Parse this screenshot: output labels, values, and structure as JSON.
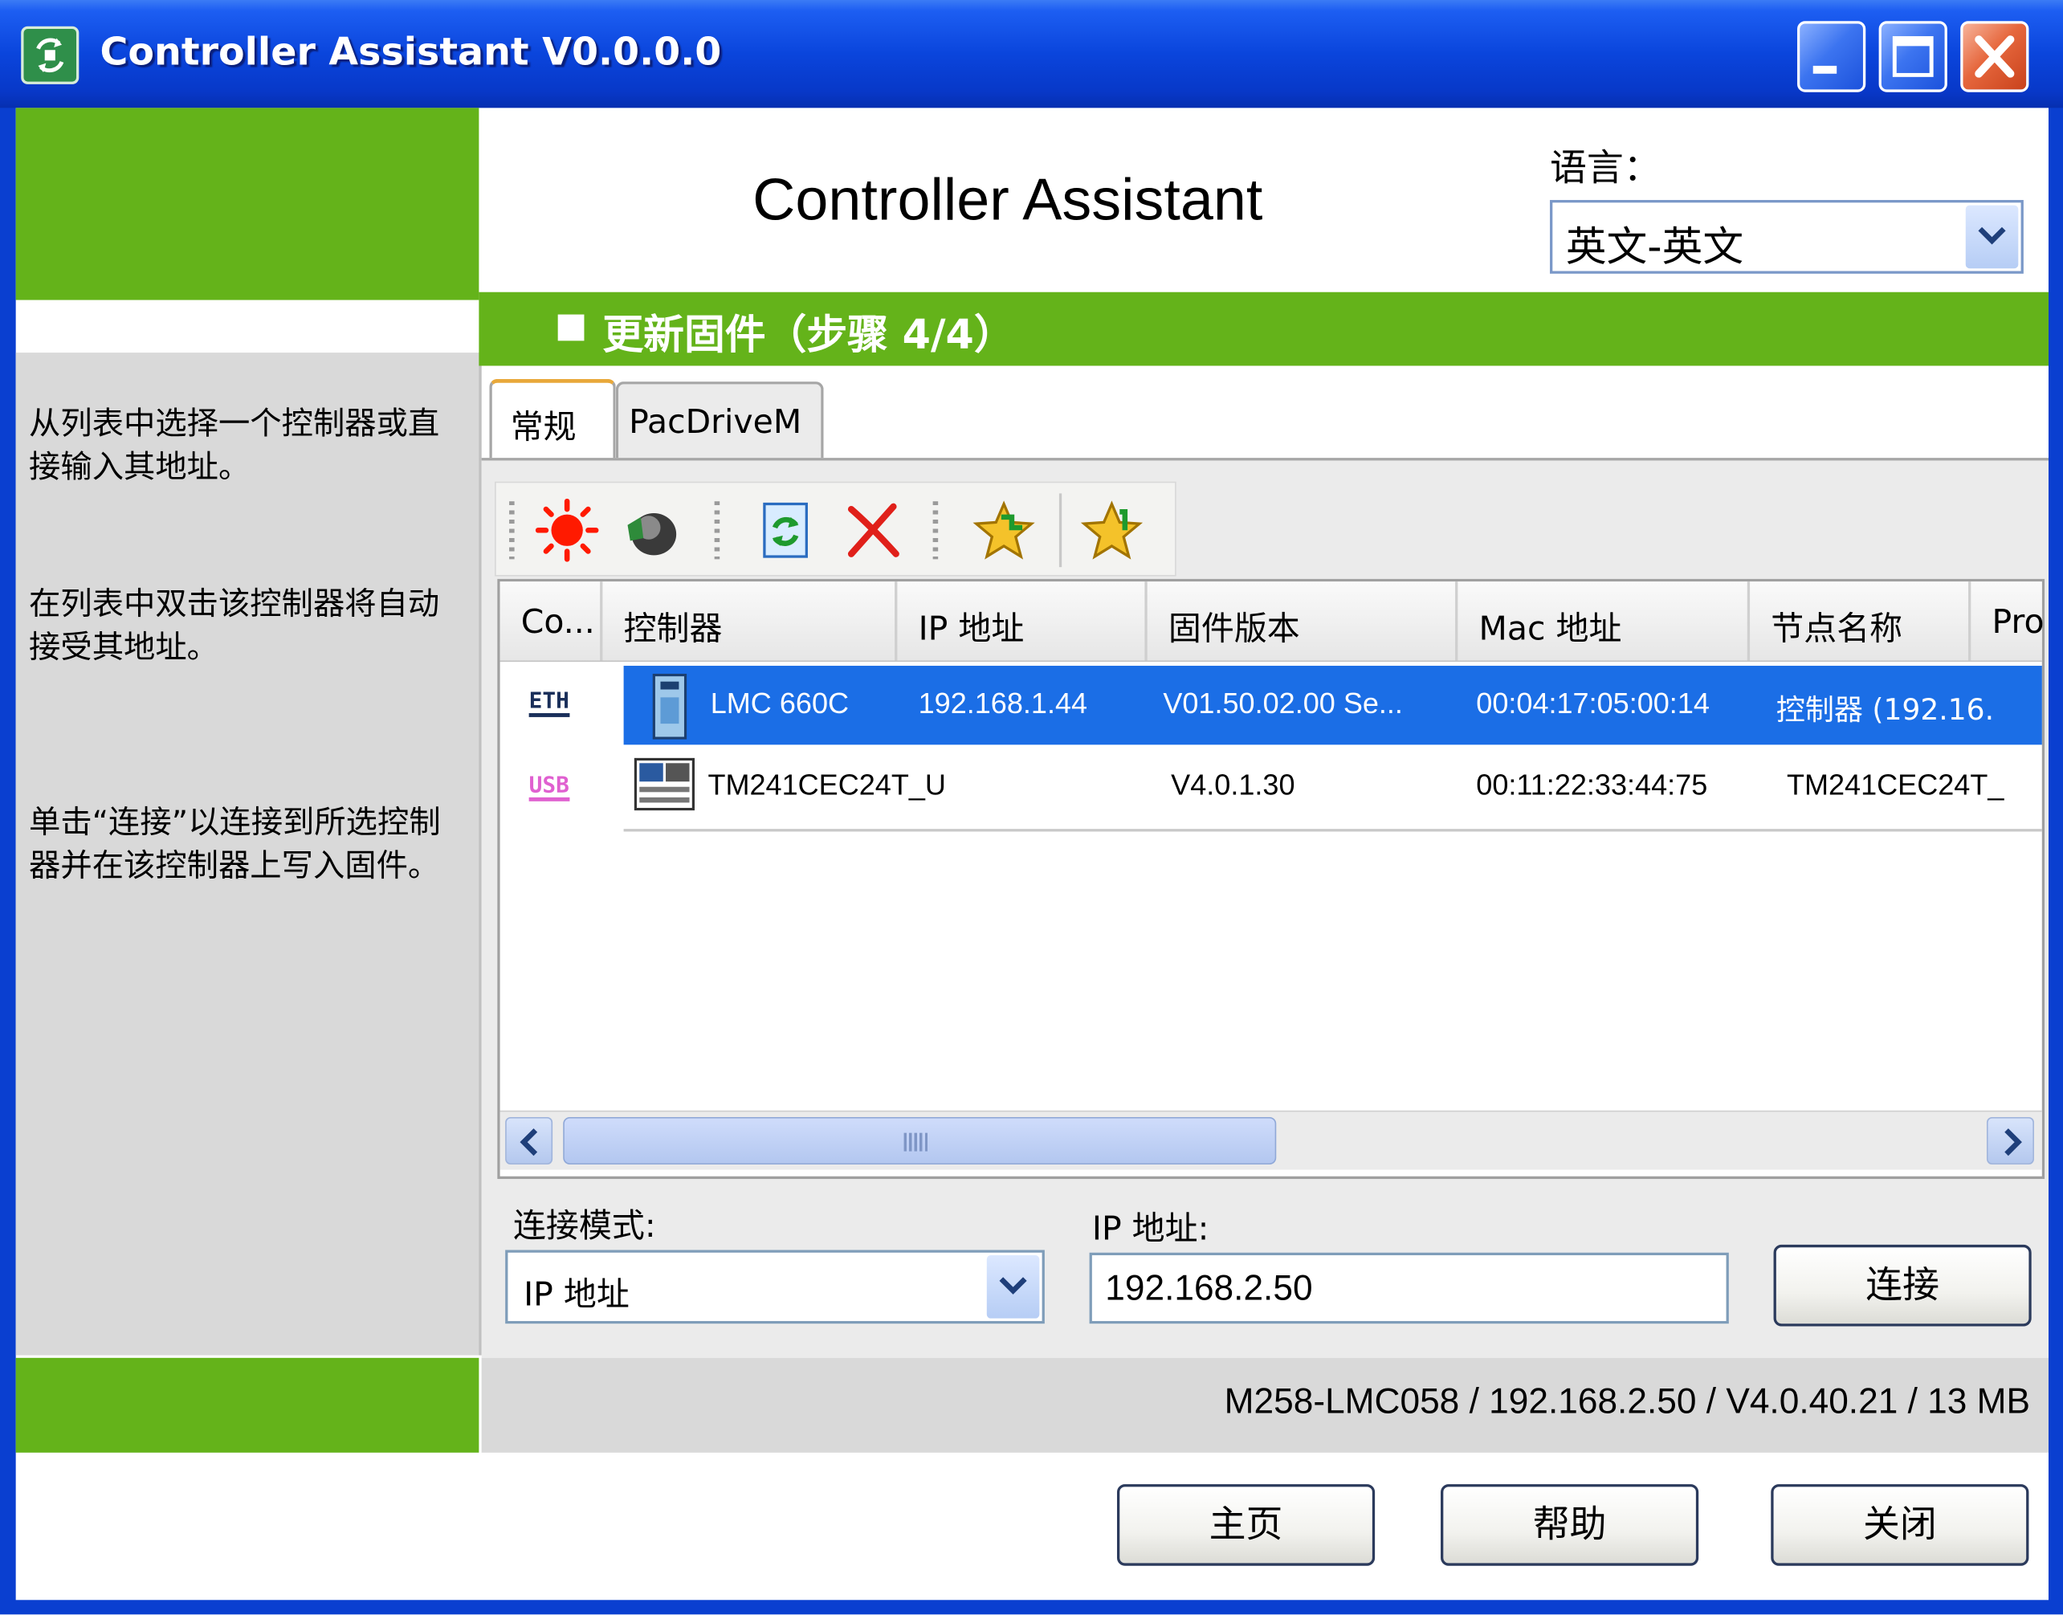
{
  "window": {
    "title": "Controller Assistant V0.0.0.0",
    "controls": [
      "minimize-icon",
      "maximize-icon",
      "close-icon"
    ]
  },
  "header": {
    "app_title": "Controller Assistant",
    "language_label": "语言：",
    "language_value": "英文-英文"
  },
  "step": {
    "title": "更新固件（步骤 4/4）"
  },
  "help": {
    "p1": "从列表中选择一个控制器或直接输入其地址。",
    "p2": "在列表中双击该控制器将自动接受其地址。",
    "p3": "单击“连接”以连接到所选控制器并在该控制器上写入固件。"
  },
  "tabs": [
    {
      "label": "常规",
      "active": true
    },
    {
      "label": "PacDriveM",
      "active": false
    }
  ],
  "toolbar": {
    "icons": [
      "blink-led-icon",
      "device-icon",
      "refresh-icon",
      "delete-icon",
      "add-favorite-icon",
      "favorite-icon"
    ]
  },
  "grid": {
    "columns": [
      "Co...",
      "控制器",
      "IP 地址",
      "固件版本",
      "Mac 地址",
      "节点名称",
      "Pro"
    ],
    "rows": [
      {
        "connection": "ETH",
        "controller": "LMC 660C",
        "ip": "192.168.1.44",
        "firmware": "V01.50.02.00 Se...",
        "mac": "00:04:17:05:00:14",
        "node": "控制器 (192.16.",
        "selected": true
      },
      {
        "connection": "USB",
        "controller": "TM241CEC24T_U",
        "ip": "",
        "firmware": "V4.0.1.30",
        "mac": "00:11:22:33:44:75",
        "node": "TM241CEC24T_",
        "selected": false
      }
    ]
  },
  "connection": {
    "mode_label": "连接模式:",
    "mode_value": "IP 地址",
    "ip_label": "IP 地址:",
    "ip_value": "192.168.2.50",
    "connect_button": "连接"
  },
  "status": {
    "text": "M258-LMC058 / 192.168.2.50 / V4.0.40.21 / 13 MB"
  },
  "footer": {
    "home_button": "主页",
    "help_button": "帮助",
    "close_button": "关闭"
  },
  "colors": {
    "title_blue": "#0a45dc",
    "accent_green": "#64b31a",
    "selection_blue": "#1b6ee6",
    "panel_gray": "#d9d9d9"
  }
}
